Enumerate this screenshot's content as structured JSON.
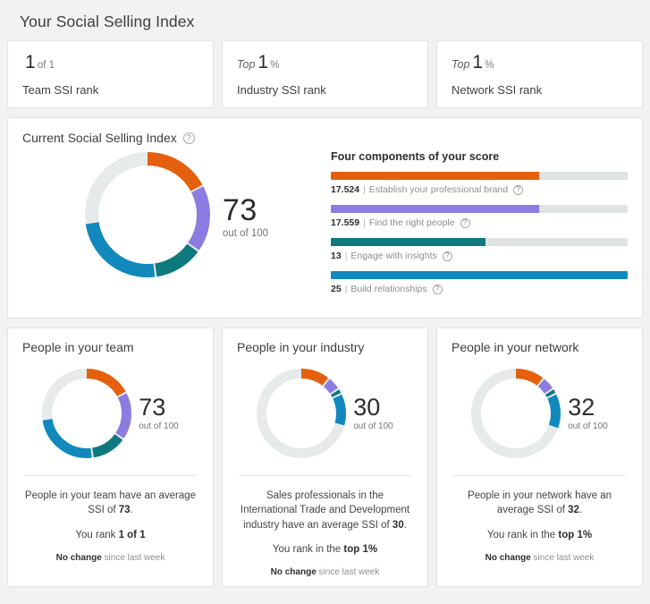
{
  "page_title": "Your Social Selling Index",
  "colors": {
    "brand_orange": "#e4600e",
    "brand_purple": "#8c7be0",
    "brand_teal": "#0e7a7f",
    "brand_blue": "#1189bd",
    "track": "#dfe3e4",
    "empty_ring": "#e6eaea",
    "page_bg": "#f3f2f0"
  },
  "rank_cards": [
    {
      "prefix": "",
      "value": "1",
      "suffix": "of 1",
      "label": "Team SSI rank"
    },
    {
      "prefix": "Top",
      "value": "1",
      "suffix": "%",
      "label": "Industry SSI rank"
    },
    {
      "prefix": "Top",
      "value": "1",
      "suffix": "%",
      "label": "Network SSI rank"
    }
  ],
  "current_ssi": {
    "title": "Current Social Selling Index",
    "help_icon": "question-circle-icon",
    "score": "73",
    "score_sub": "out of 100",
    "components_title": "Four components of your score",
    "components": [
      {
        "value": "17.524",
        "label": "Establish your professional brand",
        "color": "#e4600e",
        "pct": 70.1
      },
      {
        "value": "17.559",
        "label": "Find the right people",
        "color": "#8c7be0",
        "pct": 70.2
      },
      {
        "value": "13",
        "label": "Engage with insights",
        "color": "#0e7a7f",
        "pct": 52.0
      },
      {
        "value": "25",
        "label": "Build relationships",
        "color": "#1189bd",
        "pct": 100.0
      }
    ]
  },
  "comparison_cards": [
    {
      "title": "People in your team",
      "score": "73",
      "score_sub": "out of 100",
      "segments": [
        {
          "name": "brand",
          "value": 17.524,
          "color": "#e4600e"
        },
        {
          "name": "people",
          "value": 17.559,
          "color": "#8c7be0"
        },
        {
          "name": "insights",
          "value": 13,
          "color": "#0e7a7f"
        },
        {
          "name": "relationships",
          "value": 25,
          "color": "#1189bd"
        }
      ],
      "avg_text_pre": "People in your team have an average SSI of ",
      "avg_value": "73",
      "rank_pre": "You rank ",
      "rank_value": "1 of 1",
      "change_bold": "No change",
      "change_rest": " since last week"
    },
    {
      "title": "People in your industry",
      "score": "30",
      "score_sub": "out of 100",
      "segments": [
        {
          "name": "brand",
          "value": 11,
          "color": "#e4600e"
        },
        {
          "name": "people",
          "value": 5,
          "color": "#8c7be0"
        },
        {
          "name": "insights",
          "value": 2,
          "color": "#0e7a7f"
        },
        {
          "name": "relationships",
          "value": 12,
          "color": "#1189bd"
        }
      ],
      "avg_text_pre": "Sales professionals in the International Trade and Development industry have an average SSI of ",
      "avg_value": "30",
      "rank_pre": "You rank in the ",
      "rank_value": "top 1%",
      "change_bold": "No change",
      "change_rest": " since last week"
    },
    {
      "title": "People in your network",
      "score": "32",
      "score_sub": "out of 100",
      "segments": [
        {
          "name": "brand",
          "value": 11,
          "color": "#e4600e"
        },
        {
          "name": "people",
          "value": 5,
          "color": "#8c7be0"
        },
        {
          "name": "insights",
          "value": 2,
          "color": "#0e7a7f"
        },
        {
          "name": "relationships",
          "value": 13,
          "color": "#1189bd"
        }
      ],
      "avg_text_pre": "People in your network have an average SSI of ",
      "avg_value": "32",
      "rank_pre": "You rank in the ",
      "rank_value": "top 1%",
      "change_bold": "No change",
      "change_rest": " since last week"
    }
  ],
  "chart_data": {
    "type": "pie",
    "title": "Current Social Selling Index",
    "total": 73,
    "max": 100,
    "categories": [
      "Establish your professional brand",
      "Find the right people",
      "Engage with insights",
      "Build relationships"
    ],
    "values": [
      17.524,
      17.559,
      13,
      25
    ],
    "component_max": 25,
    "colors": [
      "#e4600e",
      "#8c7be0",
      "#0e7a7f",
      "#1189bd"
    ],
    "legend_position": "right",
    "grid": false
  }
}
